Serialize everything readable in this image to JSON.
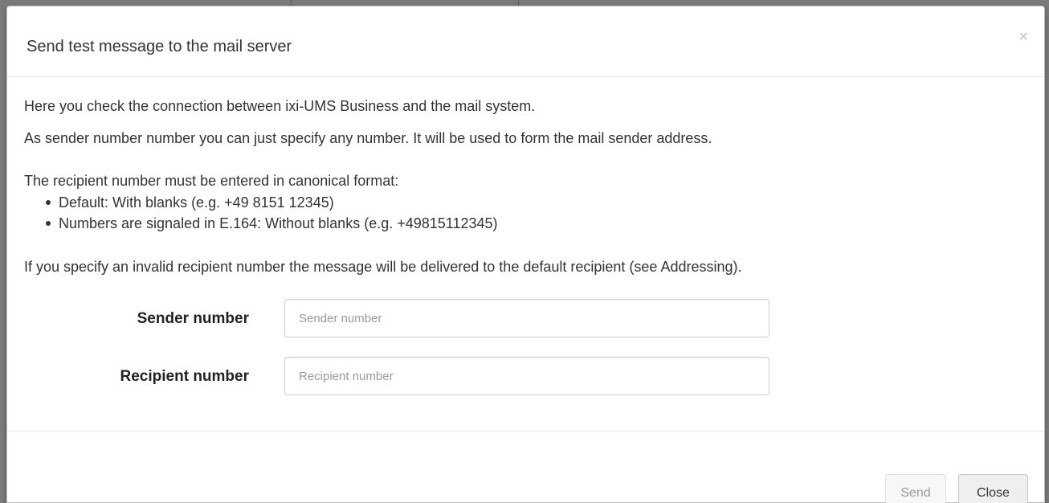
{
  "dialog": {
    "title": "Send test message to the mail server",
    "close_icon": "×"
  },
  "body": {
    "intro": "Here you check the connection between ixi-UMS Business and the mail system.",
    "sender_info": "As sender number number you can just specify any number. It will be used to form the mail sender address.",
    "recipient_format_intro": "The recipient number must be entered in canonical format:",
    "format_items": [
      "Default: With blanks (e.g. +49 8151 12345)",
      "Numbers are signaled in E.164: Without blanks (e.g. +49815112345)"
    ],
    "invalid_note": "If you specify an invalid recipient number the message will be delivered to the default recipient (see Addressing)."
  },
  "form": {
    "sender": {
      "label": "Sender number",
      "placeholder": "Sender number",
      "value": ""
    },
    "recipient": {
      "label": "Recipient number",
      "placeholder": "Recipient number",
      "value": ""
    }
  },
  "footer": {
    "send_label": "Send",
    "close_label": "Close"
  },
  "icons": {
    "close": "close-icon"
  },
  "colors": {
    "backdrop": "#7a7a7a",
    "dialog_bg": "#ffffff",
    "send_disabled_text": "#9a9a9a"
  }
}
